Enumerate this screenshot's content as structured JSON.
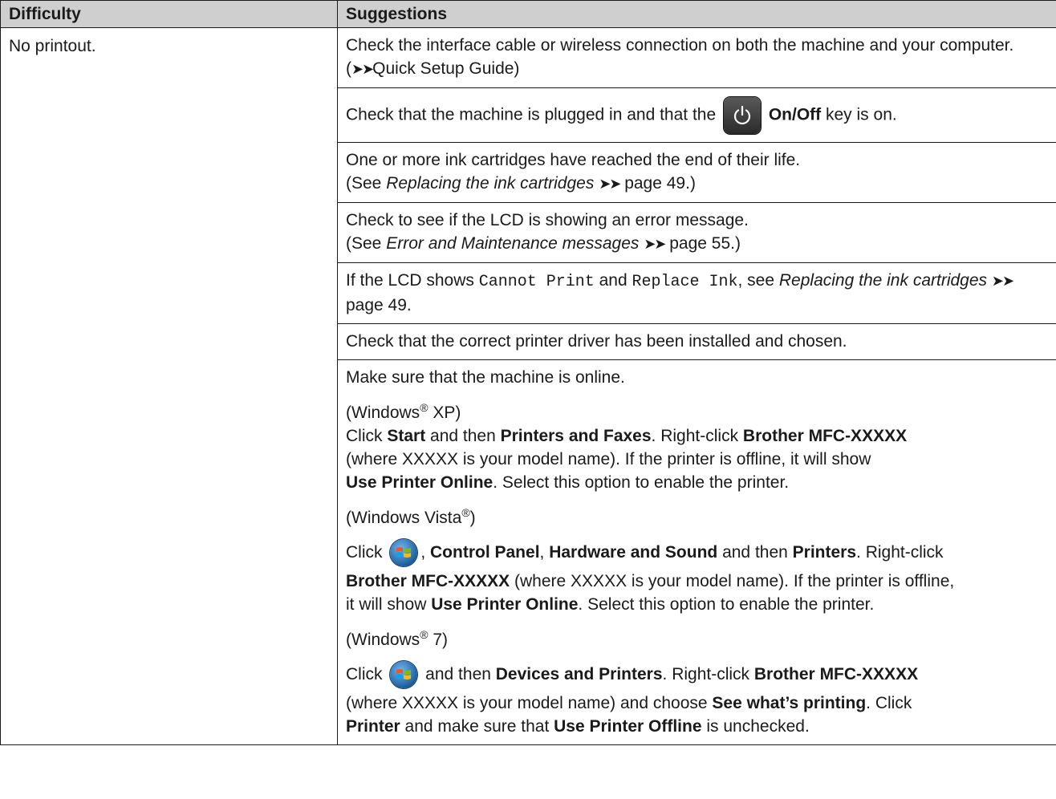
{
  "header": {
    "col1": "Difficulty",
    "col2": "Suggestions"
  },
  "difficulty": "No printout.",
  "suggestions": {
    "s1": {
      "a": "Check the interface cable or wireless connection on both the machine and your computer. (",
      "arrows": "➤➤",
      "b": "Quick Setup Guide)"
    },
    "s2": {
      "a": "Check that the machine is plugged in and that the",
      "key": "On/Off",
      "b": "key is on."
    },
    "s3": {
      "line1": "One or more ink cartridges have reached the end of their life.",
      "a": "(See ",
      "ref": "Replacing the ink cartridges",
      "arrows": "➤➤",
      "b": " page 49.)"
    },
    "s4": {
      "line1": "Check to see if the LCD is showing an error message.",
      "a": "(See ",
      "ref": "Error and Maintenance messages",
      "arrows": "➤➤",
      "b": " page 55.)"
    },
    "s5": {
      "a": "If the LCD shows ",
      "m1": "Cannot Print",
      "and": " and ",
      "m2": "Replace Ink",
      "c": ", see ",
      "ref": "Replacing the ink cartridges",
      "arrows": "➤➤",
      "b": " page 49."
    },
    "s6": {
      "text": "Check that the correct printer driver has been installed and chosen."
    },
    "s7": {
      "intro": "Make sure that the machine is online.",
      "xp": {
        "head_a": "(Windows",
        "reg": "®",
        "head_b": " XP)",
        "click": "Click ",
        "start": "Start",
        "then": " and then ",
        "pf": "Printers and Faxes",
        "rc": ". Right-click ",
        "model": "Brother MFC-XXXXX",
        "where": "(where XXXXX is your model name). If the printer is offline, it will show",
        "upo": "Use Printer Online",
        "sel": ". Select this option to enable the printer."
      },
      "vista": {
        "head_a": "(Windows Vista",
        "reg": "®",
        "head_b": ")",
        "click": "Click ",
        "cp": "Control Panel",
        "comma": ", ",
        "hs": "Hardware and Sound",
        "then": " and then ",
        "pr": "Printers",
        "rc": ". Right-click",
        "model": "Brother MFC-XXXXX",
        "where": " (where XXXXX is your model name). If the printer is offline,",
        "show": "it will show ",
        "upo": "Use Printer Online",
        "sel": ". Select this option to enable the printer."
      },
      "w7": {
        "head_a": "(Windows",
        "reg": "®",
        "head_b": " 7)",
        "click": "Click ",
        "then": " and then ",
        "dp": "Devices and Printers",
        "rc": ". Right-click ",
        "model": "Brother MFC-XXXXX",
        "where": "(where XXXXX is your model name) and choose ",
        "swp": "See what’s printing",
        "click2": ". Click",
        "printer": "Printer",
        "ms": " and make sure that ",
        "upoff": "Use Printer Offline",
        "unc": " is unchecked."
      }
    }
  },
  "icons": {
    "power": "power-key-icon",
    "windows_start": "windows-start-orb-icon"
  }
}
